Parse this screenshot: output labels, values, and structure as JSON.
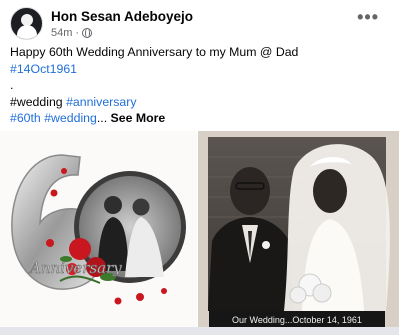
{
  "post": {
    "author": "Hon Sesan Adeboyejo",
    "time": "54m",
    "separator": "·",
    "more_label": "•••",
    "lines": {
      "line1": "Happy 60th Wedding Anniversary to my Mum @ Dad",
      "tag1": "#14Oct1961",
      "line3": ".",
      "tag_wedding": "#wedding",
      "tag_anniversary": "#anniversary",
      "tag_60th": "#60th",
      "tag_wedding2": "#wedding",
      "ellipsis": "...",
      "see_more": "See More"
    },
    "photo_left": {
      "number": "6",
      "anniversary_text": "Anniversary"
    },
    "photo_right": {
      "caption": "Our Wedding...October 14, 1961"
    }
  },
  "colors": {
    "link": "#216fdb",
    "secondary_text": "#65676b",
    "rose": "#c8171f"
  }
}
